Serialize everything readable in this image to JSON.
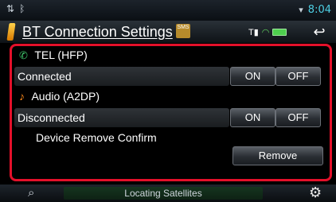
{
  "status_bar": {
    "icons": [
      "sync-icon",
      "bluetooth-icon",
      "wifi-icon"
    ],
    "time": "8:04",
    "time_color": "#4ecfe3"
  },
  "header": {
    "title": "BT Connection Settings",
    "sms_badge": "SMS",
    "back_icon": "back-arrow-icon"
  },
  "settings": {
    "tel": {
      "label": "TEL (HFP)",
      "status": "Connected",
      "on_label": "ON",
      "off_label": "OFF",
      "icon": "phone-icon"
    },
    "audio": {
      "label": "Audio (A2DP)",
      "status": "Disconnected",
      "on_label": "ON",
      "off_label": "OFF",
      "icon": "music-note-icon"
    },
    "device_remove": {
      "label": "Device Remove Confirm",
      "button_label": "Remove"
    }
  },
  "bottom_bar": {
    "status": "Locating Satellites",
    "left_icon": "navigation-icon",
    "right_icon": "settings-gear-icon"
  },
  "colors": {
    "highlight_border": "#e4102a",
    "accent": "#4ecfe3",
    "title_marker": "#ffb020"
  }
}
